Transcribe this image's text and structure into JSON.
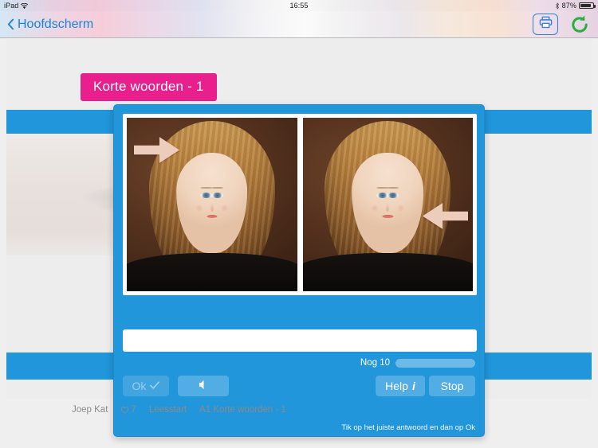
{
  "statusbar": {
    "device": "iPad",
    "wifi_icon": "wifi-icon",
    "time": "16:55",
    "bluetooth_icon": "bluetooth-icon",
    "battery_percent": "87%",
    "battery_level": 87
  },
  "navbar": {
    "back_label": "Hoofdscherm",
    "back_icon": "chevron-left-icon",
    "print_icon": "printer-icon",
    "refresh_icon": "refresh-icon"
  },
  "page": {
    "badge_label": "Korte woorden - 1",
    "badge_color": "#e81f8c",
    "accent_color": "#2196db"
  },
  "dialog": {
    "images": [
      {
        "alt": "portrait-girl-left",
        "arrow_icon": "arrow-right-icon",
        "arrow_color": "#edccbc"
      },
      {
        "alt": "portrait-girl-right",
        "arrow_icon": "arrow-left-icon",
        "arrow_color": "#edccbc"
      }
    ],
    "answer_value": "",
    "answer_placeholder": "",
    "progress_label": "Nog 10",
    "progress_remaining": 10,
    "progress_percent": 100,
    "buttons": {
      "ok_label": "Ok",
      "ok_icon": "check-icon",
      "ok_enabled": false,
      "sound_icon": "speaker-icon",
      "help_label": "Help",
      "help_icon": "info-icon",
      "stop_label": "Stop"
    },
    "hint": "Tik op het juiste antwoord en dan op Ok"
  },
  "footer": {
    "user_name": "Joep Kat",
    "favorites_icon": "heart-icon",
    "favorites_count": "7",
    "course": "Leesstart",
    "lesson": "A1 Korte woorden - 1"
  }
}
